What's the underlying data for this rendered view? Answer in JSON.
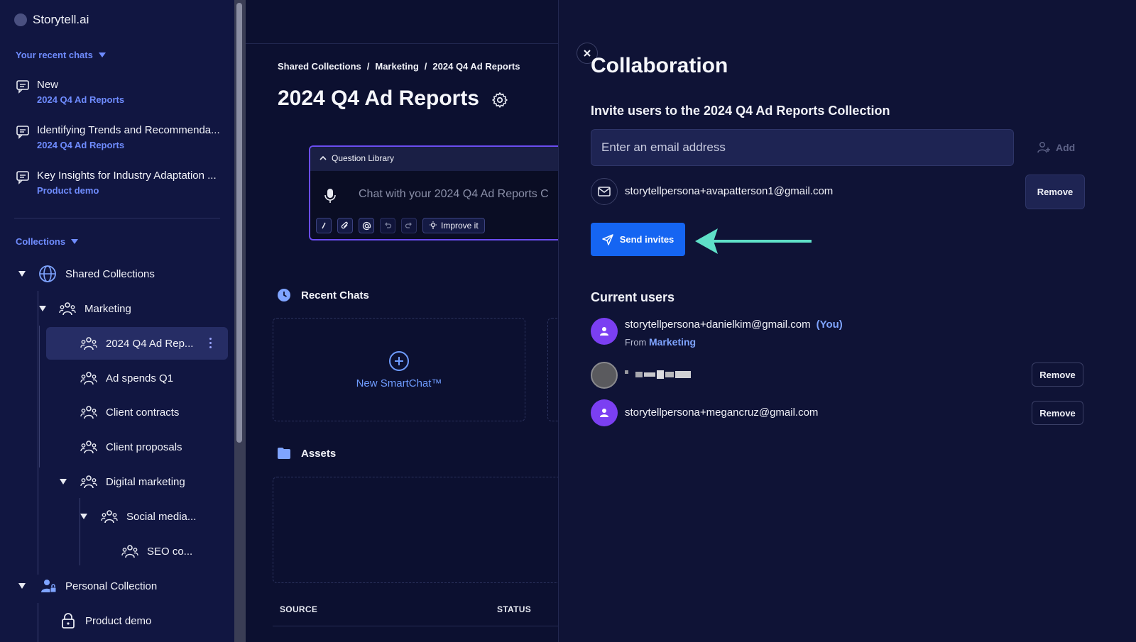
{
  "sidebar": {
    "app_name": "Storytell.ai",
    "recent_label": "Your recent chats",
    "recent_chats": [
      {
        "title": "New",
        "sub": "2024 Q4 Ad Reports"
      },
      {
        "title": "Identifying Trends and Recommenda...",
        "sub": "2024 Q4 Ad Reports"
      },
      {
        "title": "Key Insights for Industry Adaptation ...",
        "sub": "Product demo"
      }
    ],
    "collections_label": "Collections",
    "tree": {
      "shared": "Shared Collections",
      "marketing": "Marketing",
      "q4": "2024 Q4 Ad Rep...",
      "ad_spends": "Ad spends Q1",
      "client_contracts": "Client contracts",
      "client_proposals": "Client proposals",
      "digital_marketing": "Digital marketing",
      "social_media": "Social media...",
      "seo": "SEO co...",
      "personal": "Personal Collection",
      "product_demo": "Product demo"
    }
  },
  "main": {
    "breadcrumb": [
      "Shared Collections",
      "Marketing",
      "2024 Q4 Ad Reports"
    ],
    "breadcrumb_sep": "/",
    "title": "2024 Q4 Ad Reports",
    "question_library": "Question Library",
    "chat_placeholder": "Chat with your 2024 Q4 Ad Reports C",
    "improve": "Improve it",
    "recent_chats": "Recent Chats",
    "new_smartchat": "New SmartChat™",
    "assets": "Assets",
    "columns": {
      "source": "SOURCE",
      "status": "STATUS"
    }
  },
  "panel": {
    "title": "Collaboration",
    "invite_title": "Invite users to the 2024 Q4 Ad Reports Collection",
    "email_placeholder": "Enter an email address",
    "add": "Add",
    "pending_email": "storytellpersona+avapatterson1@gmail.com",
    "remove": "Remove",
    "send": "Send invites",
    "current_title": "Current users",
    "users": [
      {
        "email": "storytellpersona+danielkim@gmail.com",
        "you": "(You)",
        "from_prefix": "From",
        "from_group": "Marketing"
      },
      {
        "email": ""
      },
      {
        "email": "storytellpersona+megancruz@gmail.com"
      }
    ]
  },
  "colors": {
    "accent_blue": "#1565f2",
    "link_blue": "#6f8cff",
    "avatar_purple": "#7b3ff2",
    "arrow_teal": "#5fe0c8"
  }
}
